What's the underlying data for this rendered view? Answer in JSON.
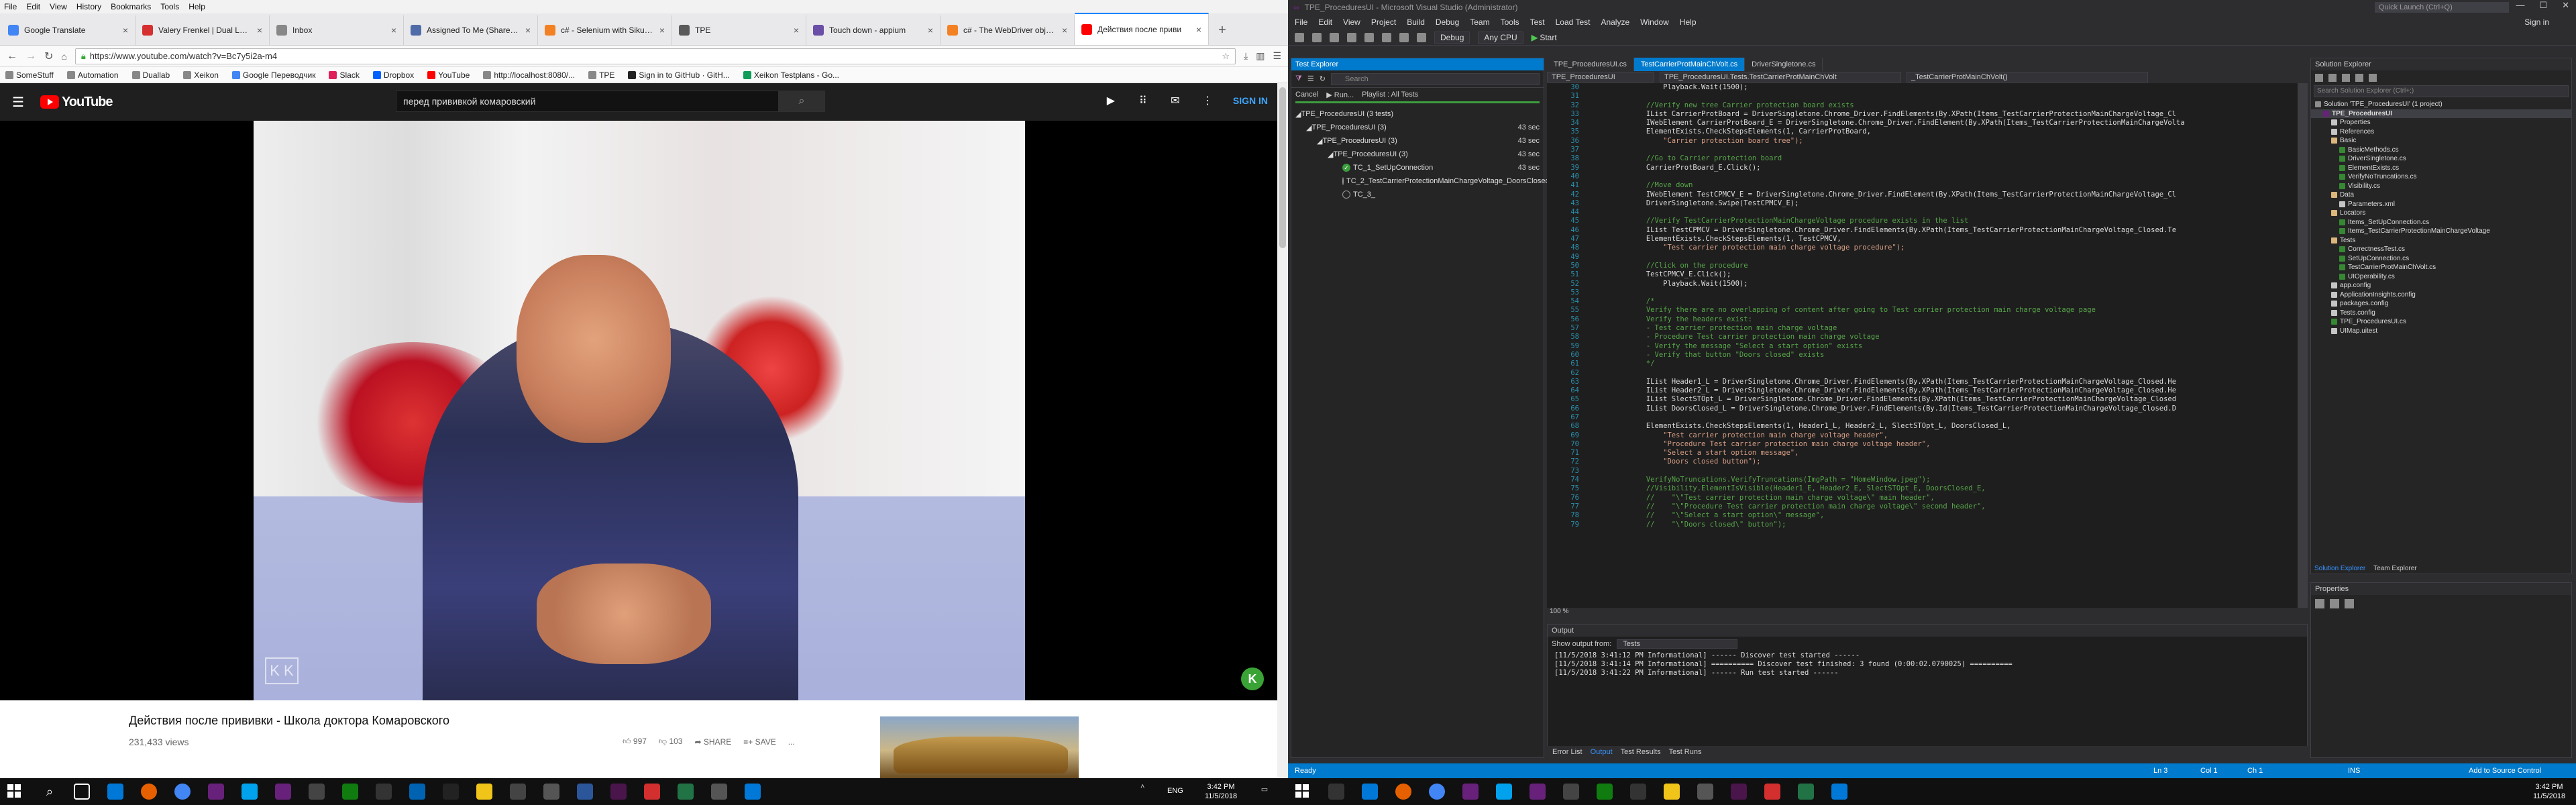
{
  "firefox": {
    "menu": [
      "File",
      "Edit",
      "View",
      "History",
      "Bookmarks",
      "Tools",
      "Help"
    ],
    "tabs": [
      {
        "title": "Google Translate",
        "color": "#4285f4"
      },
      {
        "title": "Valery Frenkel | Dual Lab S",
        "color": "#d62f2f"
      },
      {
        "title": "Inbox",
        "color": "#888888"
      },
      {
        "title": "Assigned To Me (Shared C",
        "color": "#4f6ba8"
      },
      {
        "title": "c# - Selenium with SikuliW",
        "color": "#f48024"
      },
      {
        "title": "TPE",
        "color": "#5a5a5a"
      },
      {
        "title": "Touch down - appium",
        "color": "#6b4ea8"
      },
      {
        "title": "c# - The WebDriver object",
        "color": "#f48024"
      },
      {
        "title": "Действия после приви",
        "color": "#ff0000"
      }
    ],
    "url": "https://www.youtube.com/watch?v=Bc7y5i2a-m4",
    "bookmarks": [
      "SomeStuff",
      "Automation",
      "Duallab",
      "Xeikon",
      "Google Переводчик",
      "Slack",
      "Dropbox",
      "YouTube",
      "http://localhost:8080/...",
      "TPE",
      "Sign in to GitHub · GitH...",
      "Xeikon Testplans - Go..."
    ]
  },
  "youtube": {
    "logo": "YouTube",
    "search_value": "перед прививкой комаровский",
    "sign_in": "SIGN IN",
    "title": "Действия после прививки - Школа доктора Комаровского",
    "views": "231,433 views",
    "likes": "997",
    "dislikes": "103",
    "share": "SHARE",
    "save": "SAVE",
    "more": "...",
    "badge": "K"
  },
  "vs": {
    "title": "TPE_ProceduresUI - Microsoft Visual Studio (Administrator)",
    "quick_launch": "Quick Launch (Ctrl+Q)",
    "menu": [
      "File",
      "Edit",
      "View",
      "Project",
      "Build",
      "Debug",
      "Team",
      "Tools",
      "Test",
      "Load Test",
      "Analyze",
      "Window",
      "Help"
    ],
    "sign_in": "Sign in",
    "toolbar": {
      "config": "Debug",
      "platform": "Any CPU",
      "start": "Start"
    },
    "test_explorer": {
      "title": "Test Explorer",
      "search": "Search",
      "cancel": "Cancel",
      "run": "Run...",
      "playlist": "Playlist : All Tests",
      "tree": [
        {
          "label": "TPE_ProceduresUI (3 tests)",
          "indent": 0,
          "time": "",
          "kind": "root"
        },
        {
          "label": "TPE_ProceduresUI (3)",
          "indent": 1,
          "time": "43 sec",
          "kind": "node"
        },
        {
          "label": "TPE_ProceduresUI (3)",
          "indent": 2,
          "time": "43 sec",
          "kind": "node"
        },
        {
          "label": "TPE_ProceduresUI (3)",
          "indent": 3,
          "time": "43 sec",
          "kind": "node"
        },
        {
          "label": "TC_1_SetUpConnection",
          "indent": 4,
          "time": "43 sec",
          "kind": "ok"
        },
        {
          "label": "TC_2_TestCarrierProtectionMainChargeVoltage_DoorsClosed",
          "indent": 4,
          "time": "",
          "kind": "nr"
        },
        {
          "label": "TC_3_",
          "indent": 4,
          "time": "",
          "kind": "nr"
        }
      ]
    },
    "editor": {
      "tabs": [
        "TPE_ProceduresUI.cs",
        "TestCarrierProtMainChVolt.cs",
        "DriverSingletone.cs"
      ],
      "nav": [
        "TPE_ProceduresUI",
        "TPE_ProceduresUI.Tests.TestCarrierProtMainChVolt",
        "_TestCarrierProtMainChVolt()"
      ],
      "line_numbers": [
        "30",
        "31",
        "32",
        "33",
        "34",
        "35",
        "36",
        "37",
        "38",
        "39",
        "40",
        "41",
        "42",
        "43",
        "44",
        "45",
        "46",
        "47",
        "48",
        "49",
        "50",
        "51",
        "52",
        "53",
        "54",
        "55",
        "56",
        "57",
        "58",
        "59",
        "60",
        "61",
        "62",
        "63",
        "64",
        "65",
        "66",
        "67",
        "68",
        "69",
        "70",
        "71",
        "72",
        "73",
        "74",
        "75",
        "76",
        "77",
        "78",
        "79"
      ],
      "lines": [
        "                Playback.Wait(1500);",
        "",
        "            //Verify new tree Carrier protection board exists",
        "            IList CarrierProtBoard = DriverSingletone.Chrome_Driver.FindElements(By.XPath(Items_TestCarrierProtectionMainChargeVoltage_Cl",
        "            IWebElement CarrierProtBoard_E = DriverSingletone.Chrome_Driver.FindElement(By.XPath(Items_TestCarrierProtectionMainChargeVolta",
        "            ElementExists.CheckStepsElements(1, CarrierProtBoard,",
        "                \"Carrier protection board tree\");",
        "",
        "            //Go to Carrier protection board",
        "            CarrierProtBoard_E.Click();",
        "",
        "            //Move down",
        "            IWebElement TestCPMCV_E = DriverSingletone.Chrome_Driver.FindElement(By.XPath(Items_TestCarrierProtectionMainChargeVoltage_Cl",
        "            DriverSingletone.Swipe(TestCPMCV_E);",
        "",
        "            //Verify TestCarrierProtectionMainChargeVoltage procedure exists in the list",
        "            IList TestCPMCV = DriverSingletone.Chrome_Driver.FindElements(By.XPath(Items_TestCarrierProtectionMainChargeVoltage_Closed.Te",
        "            ElementExists.CheckStepsElements(1, TestCPMCV,",
        "                \"Test carrier protection main charge voltage procedure\");",
        "",
        "            //Click on the procedure",
        "            TestCPMCV_E.Click();",
        "                Playback.Wait(1500);",
        "",
        "            /*",
        "            Verify there are no overlapping of content after going to Test carrier protection main charge voltage page",
        "            Verify the headers exist:",
        "            - Test carrier protection main charge voltage",
        "            - Procedure Test carrier protection main charge voltage",
        "            - Verify the message \"Select a start option\" exists",
        "            - Verify that button \"Doors closed\" exists",
        "            */",
        "",
        "            IList Header1_L = DriverSingletone.Chrome_Driver.FindElements(By.XPath(Items_TestCarrierProtectionMainChargeVoltage_Closed.He",
        "            IList Header2_L = DriverSingletone.Chrome_Driver.FindElements(By.XPath(Items_TestCarrierProtectionMainChargeVoltage_Closed.He",
        "            IList SlectSTOpt_L = DriverSingletone.Chrome_Driver.FindElements(By.XPath(Items_TestCarrierProtectionMainChargeVoltage_Closed",
        "            IList DoorsClosed_L = DriverSingletone.Chrome_Driver.FindElements(By.Id(Items_TestCarrierProtectionMainChargeVoltage_Closed.D",
        "",
        "            ElementExists.CheckStepsElements(1, Header1_L, Header2_L, SlectSTOpt_L, DoorsClosed_L,",
        "                \"Test carrier protection main charge voltage header\",",
        "                \"Procedure Test carrier protection main charge voltage header\",",
        "                \"Select a start option message\",",
        "                \"Doors closed button\");",
        "",
        "            VerifyNoTruncations.VerifyTruncations(ImgPath = \"HomeWindow.jpeg\");",
        "            //Visibility.ElementIsVisible(Header1_E, Header2_E, SlectSTOpt_E, DoorsClosed_E,",
        "            //    \"\\\"Test carrier protection main charge voltage\\\" main header\",",
        "            //    \"\\\"Procedure Test carrier protection main charge voltage\\\" second header\",",
        "            //    \"\\\"Select a start option\\\" message\",",
        "            //    \"\\\"Doors closed\\\" button\");"
      ],
      "zoom": "100 %"
    },
    "output": {
      "title": "Output",
      "show_from_label": "Show output from:",
      "show_from_value": "Tests",
      "lines": [
        "[11/5/2018 3:41:12 PM Informational] ------ Discover test started ------",
        "[11/5/2018 3:41:14 PM Informational] ========== Discover test finished: 3 found (0:00:02.0790025) ==========",
        "[11/5/2018 3:41:22 PM Informational] ------ Run test started ------"
      ],
      "tabs": [
        "Error List",
        "Output",
        "Test Results",
        "Test Runs"
      ]
    },
    "solution_explorer": {
      "title": "Solution Explorer",
      "search": "Search Solution Explorer (Ctrl+;)",
      "rows": [
        {
          "label": "Solution 'TPE_ProceduresUI' (1 project)",
          "indent": 0,
          "color": "#8c8c8c"
        },
        {
          "label": "TPE_ProceduresUI",
          "indent": 1,
          "color": "#68217a",
          "sel": true
        },
        {
          "label": "Properties",
          "indent": 2,
          "color": "#c5c5c5"
        },
        {
          "label": "References",
          "indent": 2,
          "color": "#c5c5c5"
        },
        {
          "label": "Basic",
          "indent": 2,
          "color": "#dcb67a"
        },
        {
          "label": "BasicMethods.cs",
          "indent": 3,
          "color": "#368832"
        },
        {
          "label": "DriverSingletone.cs",
          "indent": 3,
          "color": "#368832"
        },
        {
          "label": "ElementExists.cs",
          "indent": 3,
          "color": "#368832"
        },
        {
          "label": "VerifyNoTruncations.cs",
          "indent": 3,
          "color": "#368832"
        },
        {
          "label": "Visibility.cs",
          "indent": 3,
          "color": "#368832"
        },
        {
          "label": "Data",
          "indent": 2,
          "color": "#dcb67a"
        },
        {
          "label": "Parameters.xml",
          "indent": 3,
          "color": "#c5c5c5"
        },
        {
          "label": "Locators",
          "indent": 2,
          "color": "#dcb67a"
        },
        {
          "label": "Items_SetUpConnection.cs",
          "indent": 3,
          "color": "#368832"
        },
        {
          "label": "Items_TestCarrierProtectionMainChargeVoltage",
          "indent": 3,
          "color": "#368832"
        },
        {
          "label": "Tests",
          "indent": 2,
          "color": "#dcb67a"
        },
        {
          "label": "CorrectnessTest.cs",
          "indent": 3,
          "color": "#368832"
        },
        {
          "label": "SetUpConnection.cs",
          "indent": 3,
          "color": "#368832"
        },
        {
          "label": "TestCarrierProtMainChVolt.cs",
          "indent": 3,
          "color": "#368832"
        },
        {
          "label": "UIOperability.cs",
          "indent": 3,
          "color": "#368832"
        },
        {
          "label": "app.config",
          "indent": 2,
          "color": "#c5c5c5"
        },
        {
          "label": "ApplicationInsights.config",
          "indent": 2,
          "color": "#c5c5c5"
        },
        {
          "label": "packages.config",
          "indent": 2,
          "color": "#c5c5c5"
        },
        {
          "label": "Tests.config",
          "indent": 2,
          "color": "#c5c5c5"
        },
        {
          "label": "TPE_ProceduresUI.cs",
          "indent": 2,
          "color": "#368832"
        },
        {
          "label": "UIMap.uitest",
          "indent": 2,
          "color": "#c5c5c5"
        }
      ],
      "tabs": [
        "Solution Explorer",
        "Team Explorer"
      ]
    },
    "properties": {
      "title": "Properties"
    },
    "status": {
      "ready": "Ready",
      "ln": "Ln 3",
      "col": "Col 1",
      "ch": "Ch 1",
      "ins": "INS",
      "add_sc": "Add to Source Control"
    }
  },
  "taskbar": {
    "left": {
      "lang": "ENG",
      "time": "3:42 PM",
      "date": "11/5/2018"
    },
    "right": {
      "time": "3:42 PM",
      "date": "11/5/2018"
    }
  }
}
